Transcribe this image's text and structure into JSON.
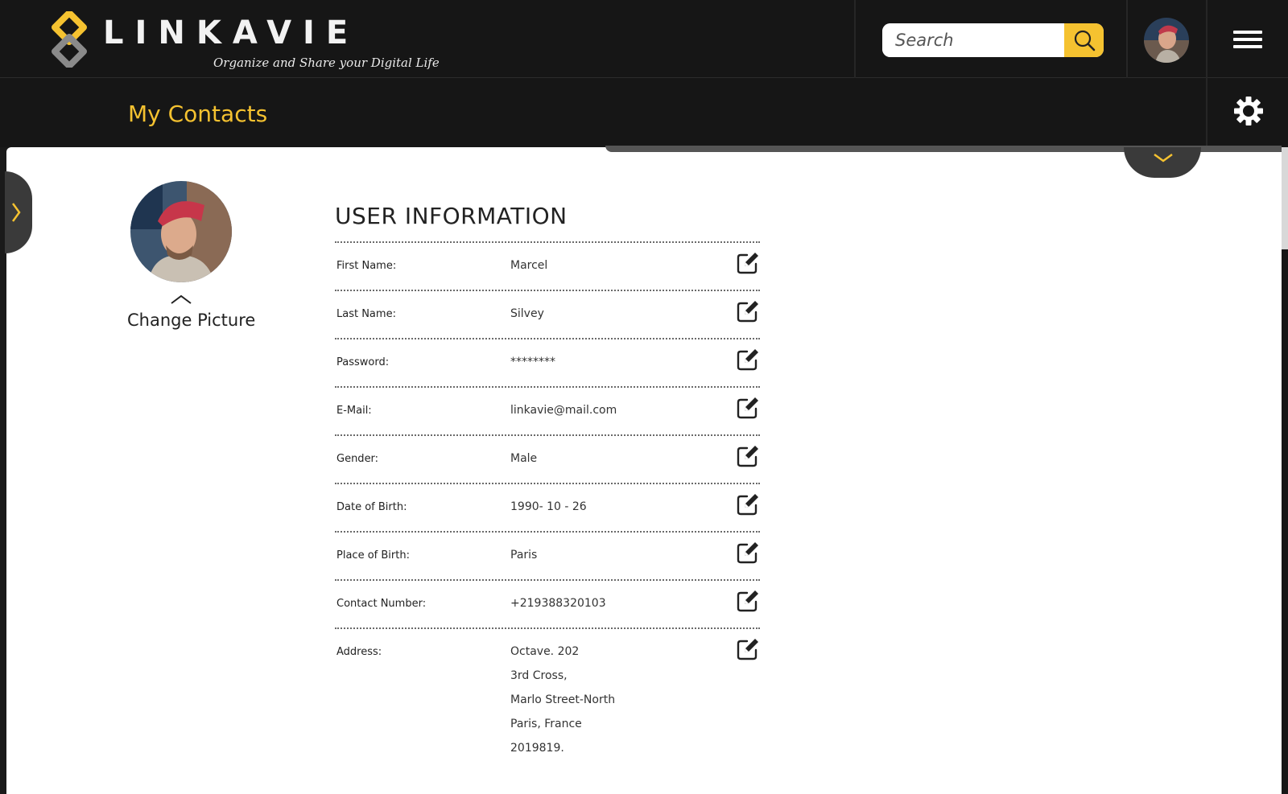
{
  "brand": {
    "name": "LINKAVIE",
    "tagline": "Organize and Share your Digital Life"
  },
  "search": {
    "placeholder": "Search"
  },
  "page": {
    "title": "My Contacts"
  },
  "profile": {
    "change_picture_label": "Change Picture"
  },
  "user_info": {
    "title": "USER INFORMATION",
    "fields": [
      {
        "label": "First Name:",
        "value": "Marcel"
      },
      {
        "label": "Last Name:",
        "value": "Silvey"
      },
      {
        "label": "Password:",
        "value": "********"
      },
      {
        "label": "E-Mail:",
        "value": "linkavie@mail.com"
      },
      {
        "label": "Gender:",
        "value": "Male"
      },
      {
        "label": "Date of Birth:",
        "value": "1990- 10 - 26"
      },
      {
        "label": "Place of Birth:",
        "value": "Paris"
      },
      {
        "label": "Contact Number:",
        "value": "+219388320103"
      }
    ],
    "address": {
      "label": "Address:",
      "lines": [
        "Octave. 202",
        "3rd Cross,",
        "Marlo Street-North",
        "Paris, France",
        "2019819."
      ]
    }
  },
  "colors": {
    "accent": "#f5c230",
    "bar_bg": "#161616",
    "content_bg": "#ffffff"
  },
  "icons": {
    "search": "search-icon",
    "menu": "hamburger-menu-icon",
    "settings": "gear-icon",
    "edit": "edit-icon",
    "expand_left": "chevron-right-icon",
    "expand_down": "chevron-down-icon",
    "collapse": "chevron-up-icon"
  }
}
